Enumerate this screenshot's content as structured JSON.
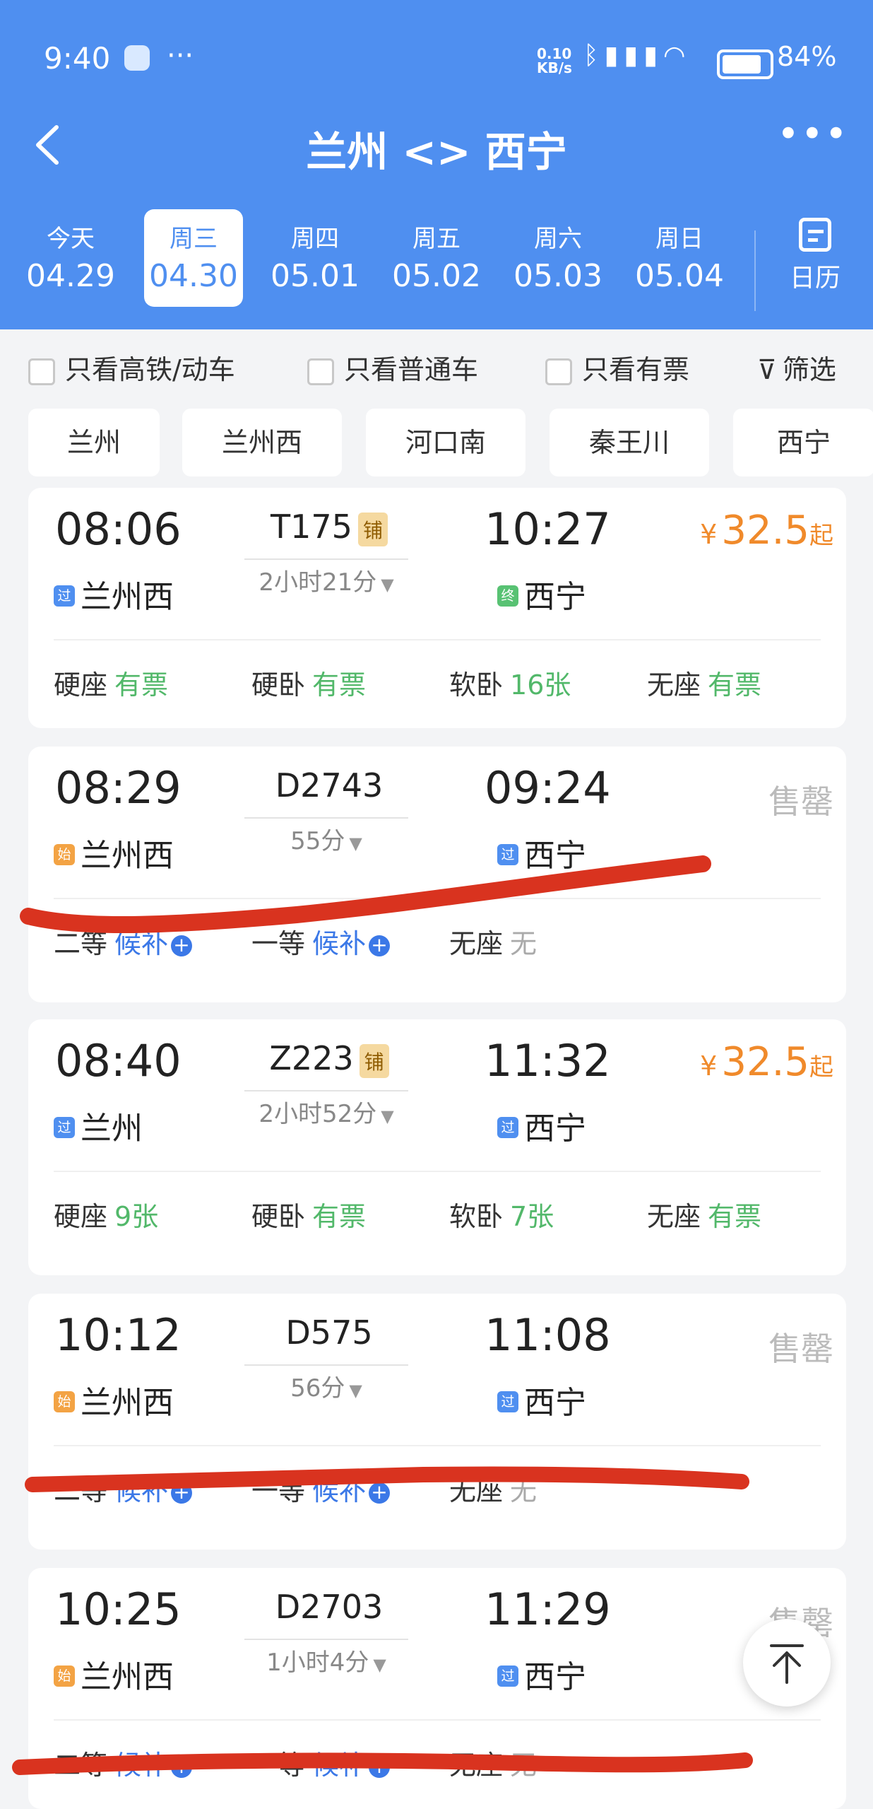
{
  "status": {
    "time": "9:40",
    "app_dots": "···",
    "net_speed_top": "0.10",
    "net_speed_bottom": "KB/s",
    "battery": "84%",
    "battery_level": 0.84
  },
  "header": {
    "title": "兰州 <> 西宁"
  },
  "dates": [
    {
      "weekday": "今天",
      "date": "04.29",
      "selected": false
    },
    {
      "weekday": "周三",
      "date": "04.30",
      "selected": true
    },
    {
      "weekday": "周四",
      "date": "05.01",
      "selected": false
    },
    {
      "weekday": "周五",
      "date": "05.02",
      "selected": false
    },
    {
      "weekday": "周六",
      "date": "05.03",
      "selected": false
    },
    {
      "weekday": "周日",
      "date": "05.04",
      "selected": false
    }
  ],
  "calendar_label": "日历",
  "filters": {
    "gaotie": "只看高铁/动车",
    "putong": "只看普通车",
    "youpiao": "只看有票",
    "shaixuan": "筛选"
  },
  "stations": [
    "兰州",
    "兰州西",
    "河口南",
    "秦王川",
    "西宁"
  ],
  "trains": [
    {
      "dep_time": "08:06",
      "arr_time": "10:27",
      "train_no": "T175",
      "berth": "铺",
      "duration": "2小时21分",
      "dep_tag": "过",
      "dep_station": "兰州西",
      "arr_tag": "终",
      "arr_station": "西宁",
      "price_symbol": "¥",
      "price": "32.5",
      "price_suffix": "起",
      "seats": [
        {
          "name": "硬座",
          "status": "有票"
        },
        {
          "name": "硬卧",
          "status": "有票"
        },
        {
          "name": "软卧",
          "status": "16张"
        },
        {
          "name": "无座",
          "status": "有票"
        }
      ]
    },
    {
      "dep_time": "08:29",
      "arr_time": "09:24",
      "train_no": "D2743",
      "duration": "55分",
      "dep_tag": "始",
      "dep_station": "兰州西",
      "arr_tag": "过",
      "arr_station": "西宁",
      "soldout": "售罄",
      "seats": [
        {
          "name": "二等",
          "status": "候补"
        },
        {
          "name": "一等",
          "status": "候补"
        },
        {
          "name": "无座",
          "status": "无"
        }
      ]
    },
    {
      "dep_time": "08:40",
      "arr_time": "11:32",
      "train_no": "Z223",
      "berth": "铺",
      "duration": "2小时52分",
      "dep_tag": "过",
      "dep_station": "兰州",
      "arr_tag": "过",
      "arr_station": "西宁",
      "price_symbol": "¥",
      "price": "32.5",
      "price_suffix": "起",
      "seats": [
        {
          "name": "硬座",
          "status": "9张"
        },
        {
          "name": "硬卧",
          "status": "有票"
        },
        {
          "name": "软卧",
          "status": "7张"
        },
        {
          "name": "无座",
          "status": "有票"
        }
      ]
    },
    {
      "dep_time": "10:12",
      "arr_time": "11:08",
      "train_no": "D575",
      "duration": "56分",
      "dep_tag": "始",
      "dep_station": "兰州西",
      "arr_tag": "过",
      "arr_station": "西宁",
      "soldout": "售罄",
      "seats": [
        {
          "name": "二等",
          "status": "候补"
        },
        {
          "name": "一等",
          "status": "候补"
        },
        {
          "name": "无座",
          "status": "无"
        }
      ]
    },
    {
      "dep_time": "10:25",
      "arr_time": "11:29",
      "train_no": "D2703",
      "duration": "1小时4分",
      "dep_tag": "始",
      "dep_station": "兰州西",
      "arr_tag": "过",
      "arr_station": "西宁",
      "soldout": "售罄",
      "seats": [
        {
          "name": "二等",
          "status": "候补"
        },
        {
          "name": "一等",
          "status": "候补"
        },
        {
          "name": "无座",
          "status": "无"
        }
      ]
    }
  ],
  "colors": {
    "header": "#4f8ff0",
    "accent_price": "#f08a2b",
    "available": "#52b86a",
    "waitlist": "#3b78e7",
    "scribble": "#d9331f"
  },
  "icons": {
    "back": "chevron-left-icon",
    "more": "more-icon",
    "calendar": "calendar-icon",
    "filter": "funnel-icon",
    "to_top": "arrow-up-icon"
  }
}
